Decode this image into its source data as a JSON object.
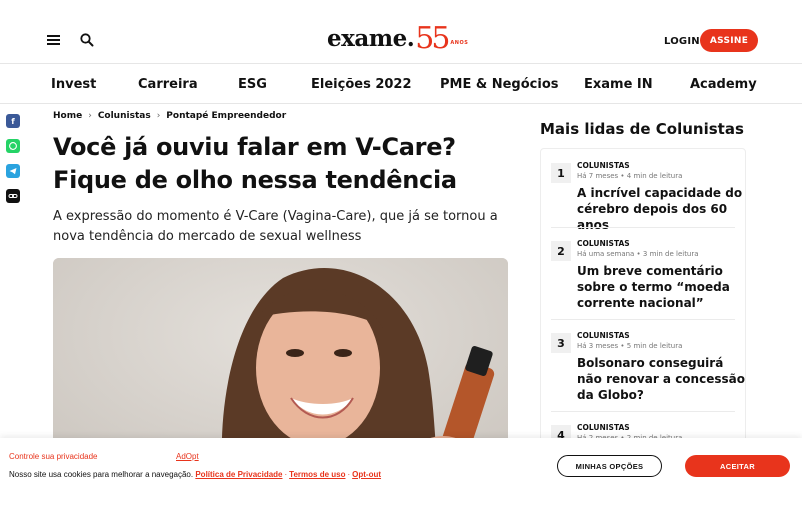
{
  "header": {
    "logo_word": "exame.",
    "logo_number": "55",
    "logo_suffix": "ANOS",
    "login_label": "LOGIN",
    "subscribe_label": "ASSINE"
  },
  "nav": {
    "items": [
      "Invest",
      "Carreira",
      "ESG",
      "Eleições 2022",
      "PME & Negócios",
      "Exame IN",
      "Academy"
    ]
  },
  "breadcrumb": [
    "Home",
    "Colunistas",
    "Pontapé Empreendedor"
  ],
  "article": {
    "title": "Você já ouviu falar em V-Care? Fique de olho nessa tendência",
    "subtitle": "A expressão do momento é V-Care (Vagina-Care), que já se tornou a nova tendência do mercado de sexual wellness"
  },
  "sidebar": {
    "title": "Mais lidas de Colunistas",
    "items": [
      {
        "rank": "1",
        "category": "COLUNISTAS",
        "meta": "Há 7 meses • 4 min de leitura",
        "headline": "A incrível capacidade do cérebro depois dos 60 anos"
      },
      {
        "rank": "2",
        "category": "COLUNISTAS",
        "meta": "Há uma semana • 3 min de leitura",
        "headline": "Um breve comentário sobre o termo “moeda corrente nacional”"
      },
      {
        "rank": "3",
        "category": "COLUNISTAS",
        "meta": "Há 3 meses • 5 min de leitura",
        "headline": "Bolsonaro conseguirá não renovar a concessão da Globo?"
      },
      {
        "rank": "4",
        "category": "COLUNISTAS",
        "meta": "Há 2 meses • 2 min de leitura",
        "headline": ""
      }
    ]
  },
  "cookie": {
    "title": "Controle sua privacidade",
    "provider": "AdOpt",
    "text": "Nosso site usa cookies para melhorar a navegação.",
    "privacy_link": "Política de Privacidade",
    "terms_link": "Termos de uso",
    "optout_link": "Opt-out",
    "options_label": "MINHAS OPÇÕES",
    "accept_label": "ACEITAR"
  },
  "colors": {
    "brand": "#e8341c",
    "facebook": "#3b5998",
    "whatsapp": "#25d366",
    "telegram": "#2aa3df"
  },
  "icons": [
    "menu-icon",
    "search-icon",
    "facebook-icon",
    "whatsapp-icon",
    "telegram-icon",
    "link-icon",
    "chevron-right-icon"
  ]
}
